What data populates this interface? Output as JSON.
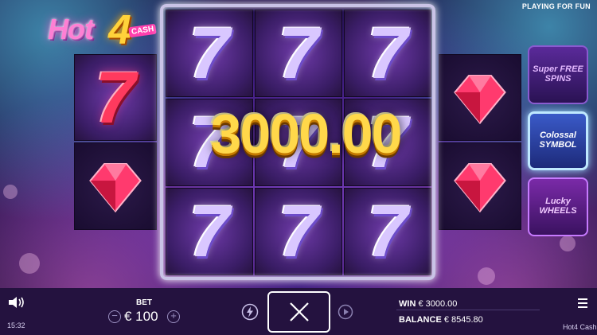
{
  "header": {
    "logo": {
      "hot": "Hot",
      "four": "4",
      "cash": "CASH"
    },
    "playing_for_fun": "PLAYING FOR FUN"
  },
  "reels": {
    "left_column": [
      "red-seven",
      "ruby-gem"
    ],
    "grid": [
      [
        "silver-seven",
        "silver-seven",
        "silver-seven"
      ],
      [
        "silver-seven",
        "silver-seven",
        "silver-seven"
      ],
      [
        "silver-seven",
        "silver-seven",
        "silver-seven"
      ]
    ],
    "right_column": [
      "ruby-gem",
      "ruby-gem"
    ],
    "seven_glyph": "7",
    "win_amount": "3000.00"
  },
  "features": [
    {
      "label": "Super FREE SPINS",
      "color": "#b85cff"
    },
    {
      "label": "Colossal SYMBOL",
      "color": "#7fd8ff"
    },
    {
      "label": "Lucky WHEELS",
      "color": "#d26bff"
    }
  ],
  "controls": {
    "bet_label": "BET",
    "bet_value": "€ 100",
    "minus": "−",
    "plus": "+",
    "win_label": "WIN",
    "win_value": "€ 3000.00",
    "balance_label": "BALANCE",
    "balance_value": "€ 8545.80",
    "time": "15:32",
    "game_name": "Hot4 Cash"
  },
  "icons": [
    "speaker-icon",
    "lightning-icon",
    "close-icon",
    "play-icon",
    "menu-icon"
  ],
  "colors": {
    "bar_bg": "#24123f",
    "accent_gold": "#ffd84a",
    "gem": "#ff3a6e"
  }
}
